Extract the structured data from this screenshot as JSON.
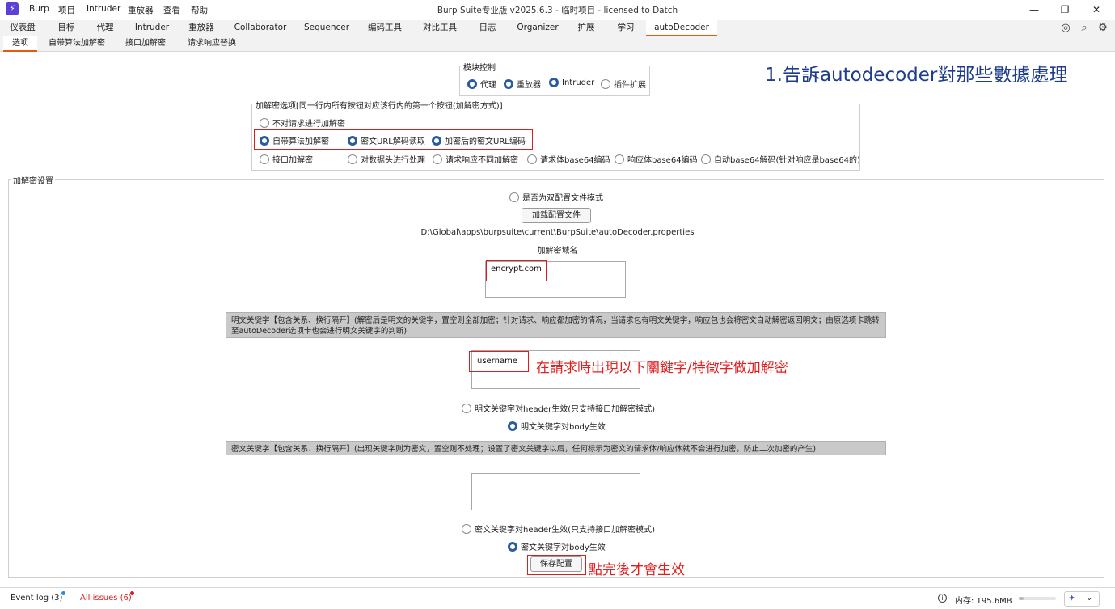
{
  "titlebar": {
    "logo": "⚡",
    "menu": [
      "Burp",
      "项目",
      "Intruder",
      "重放器",
      "查看",
      "帮助"
    ],
    "title": "Burp Suite专业版  v2025.6.3 - 临时项目 - licensed to Datch"
  },
  "main_tabs": [
    "仪表盘",
    "目标",
    "代理",
    "Intruder",
    "重放器",
    "Collaborator",
    "Sequencer",
    "编码工具",
    "对比工具",
    "日志",
    "Organizer",
    "扩展",
    "学习",
    "autoDecoder"
  ],
  "active_main_tab": "autoDecoder",
  "sub_tabs": [
    "选项",
    "自带算法加解密",
    "接口加解密",
    "请求响应替换"
  ],
  "active_sub_tab": "选项",
  "module_control": {
    "legend": "模块控制",
    "options": [
      {
        "label": "代理",
        "checked": true
      },
      {
        "label": "重放器",
        "checked": true
      },
      {
        "label": "Intruder",
        "checked": true
      },
      {
        "label": "插件扩展",
        "checked": false
      }
    ]
  },
  "annotations": {
    "top_right": "1.告訴autodecoder對那些數據處理",
    "keyword_note": "在請求時出現以下關鍵字/特徵字做加解密",
    "save_note": "點完後才會生效"
  },
  "crypto_options": {
    "legend": "加解密选项[同一行内所有按钮对应该行内的第一个按钮(加解密方式)]",
    "row1": [
      {
        "label": "不对请求进行加解密",
        "checked": false
      }
    ],
    "row2": [
      {
        "label": "自带算法加解密",
        "checked": true
      },
      {
        "label": "密文URL解码读取",
        "checked": true
      },
      {
        "label": "加密后的密文URL编码",
        "checked": true
      }
    ],
    "row3": [
      {
        "label": "接口加解密",
        "checked": false
      },
      {
        "label": "对数据头进行处理",
        "checked": false
      },
      {
        "label": "请求响应不同加解密",
        "checked": false
      },
      {
        "label": "请求体base64编码",
        "checked": false
      },
      {
        "label": "响应体base64编码",
        "checked": false
      },
      {
        "label": "自动base64解码(针对响应是base64的)",
        "checked": false
      }
    ]
  },
  "settings": {
    "legend": "加解密设置",
    "dual_config_label": "是否为双配置文件模式",
    "load_config_button": "加载配置文件",
    "config_path": "D:\\Global\\apps\\burpsuite\\current\\BurpSuite\\autoDecoder.properties",
    "domain_label": "加解密域名",
    "domain_value": "encrypt.com",
    "plain_keyword_desc": "明文关键字【包含关系、换行隔开】(解密后是明文的关键字，置空则全部加密；针对请求、响应都加密的情况，当请求包有明文关键字，响应包也会将密文自动解密返回明文；由原选项卡跳转至autoDecoder选项卡也会进行明文关键字的判断)",
    "plain_keyword_value": "username",
    "plain_header_label": "明文关键字对header生效(只支持接口加解密模式)",
    "plain_body_label": "明文关键字对body生效",
    "cipher_keyword_desc": "密文关键字【包含关系、换行隔开】(出现关键字则为密文，置空则不处理；设置了密文关键字以后，任何标示为密文的请求体/响应体就不会进行加密，防止二次加密的产生)",
    "cipher_keyword_value": "",
    "cipher_header_label": "密文关键字对header生效(只支持接口加解密模式)",
    "cipher_body_label": "密文关键字对body生效",
    "save_button": "保存配置"
  },
  "statusbar": {
    "event_log": "Event log (3)",
    "all_issues": "All issues (6)",
    "memory": "内存: 195.6MB"
  },
  "colors": {
    "accent_orange": "#e8590c",
    "radio_blue": "#2a5b9a",
    "annotation_red": "#e02020",
    "annotation_blue": "#1f3d8a"
  }
}
